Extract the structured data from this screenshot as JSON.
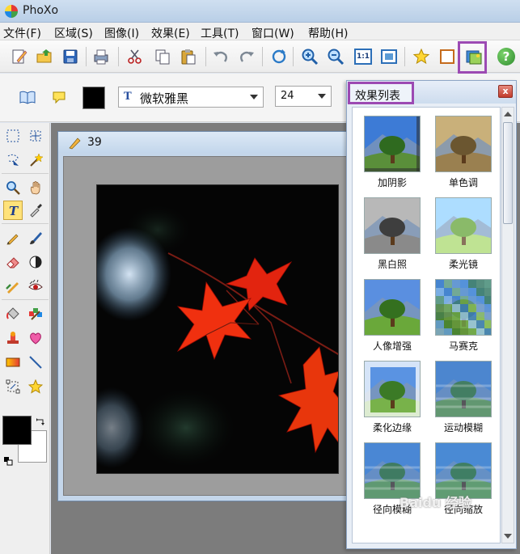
{
  "window": {
    "title": "PhoXo"
  },
  "menu": [
    "文件(F)",
    "区域(S)",
    "图像(I)",
    "效果(E)",
    "工具(T)",
    "窗口(W)",
    "帮助(H)"
  ],
  "toolbar": {
    "zoom_1to1_label": "1:1",
    "help_label": "?",
    "icons": [
      "new-file-icon",
      "open-folder-icon",
      "save-icon",
      "print-icon",
      "cut-icon",
      "copy-icon",
      "paste-icon",
      "undo-icon",
      "redo-icon",
      "rotate-icon",
      "zoom-in-icon",
      "zoom-out-icon",
      "zoom-actual-size-icon",
      "fit-window-icon",
      "favorite-star-icon",
      "frame-icon",
      "effects-list-icon",
      "help-icon"
    ]
  },
  "text_options": {
    "font_family": "微软雅黑",
    "font_size": "24",
    "font_icon_label": "T",
    "text_color": "#000000"
  },
  "document": {
    "title": "39"
  },
  "effects_panel": {
    "title": "效果列表",
    "close_label": "x",
    "items": [
      {
        "name": "加阴影",
        "style": "shadow"
      },
      {
        "name": "单色调",
        "style": "sepia"
      },
      {
        "name": "黑白照",
        "style": "grayscale"
      },
      {
        "name": "柔光镜",
        "style": "softlight"
      },
      {
        "name": "人像增强",
        "style": "portrait"
      },
      {
        "name": "马赛克",
        "style": "mosaic"
      },
      {
        "name": "柔化边缘",
        "style": "softedge"
      },
      {
        "name": "运动模糊",
        "style": "motion"
      },
      {
        "name": "径向模糊",
        "style": "radial"
      },
      {
        "name": "径向缩放",
        "style": "zoom"
      }
    ]
  },
  "colors": {
    "foreground": "#000000",
    "background": "#ffffff",
    "highlight": "#9c4ab3"
  },
  "watermark": "Baidu 经验"
}
